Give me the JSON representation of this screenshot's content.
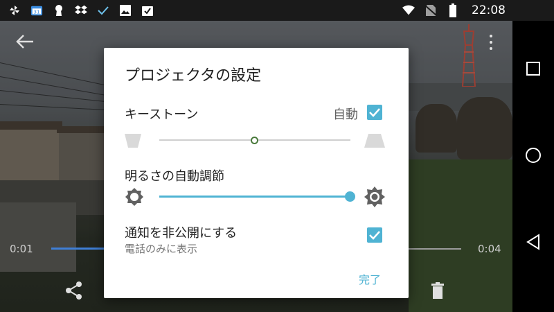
{
  "status_bar": {
    "time": "22:08",
    "icons_left": [
      "pinwheel-icon",
      "calendar-icon",
      "keyhole-icon",
      "dropbox-icon",
      "check-icon",
      "image-icon",
      "clipboard-check-icon"
    ],
    "icons_right": [
      "wifi-icon",
      "no-sim-icon",
      "battery-icon"
    ]
  },
  "video": {
    "time_start": "0:01",
    "time_end": "0:04",
    "progress_fraction": 0.13,
    "accent": "#3f7fd6"
  },
  "dialog": {
    "title": "プロジェクタの設定",
    "keystone": {
      "label": "キーストーン",
      "auto_label": "自動",
      "auto_checked": true,
      "value_fraction": 0.5
    },
    "brightness": {
      "label": "明るさの自動調節",
      "value_fraction": 1.0
    },
    "notification": {
      "label": "通知を非公開にする",
      "sublabel": "電話のみに表示",
      "checked": true
    },
    "done_label": "完了",
    "accent": "#4fb3d3"
  },
  "navbar": {
    "buttons": [
      "recents-square-icon",
      "home-circle-icon",
      "back-triangle-icon"
    ]
  }
}
